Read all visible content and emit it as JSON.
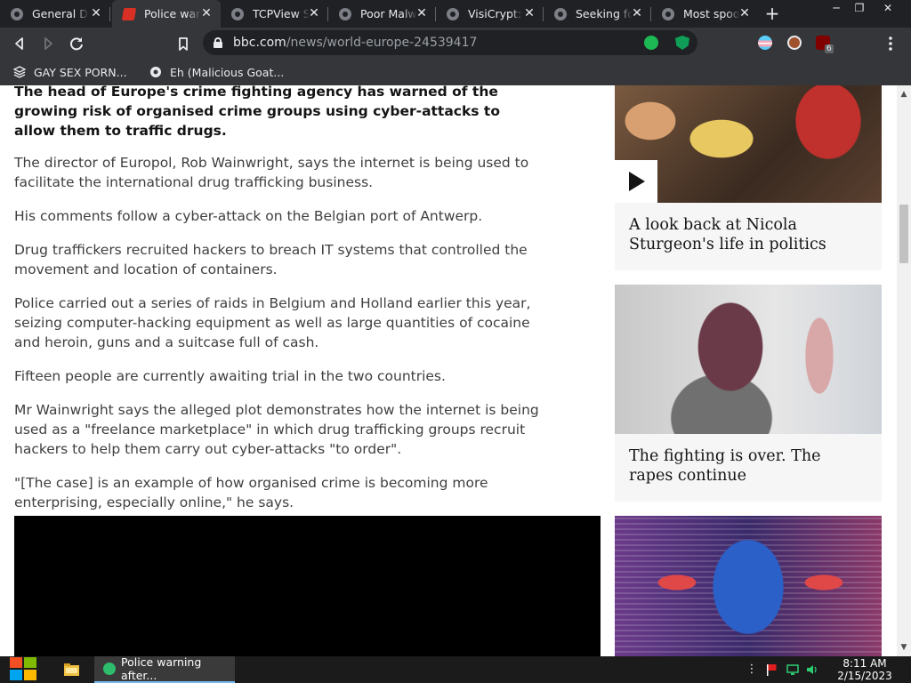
{
  "browser": {
    "tabs": [
      {
        "title": "General Discussion"
      },
      {
        "title": "Police warning after drug traffickers' cyber-attack"
      },
      {
        "title": "TCPView Sysinternals"
      },
      {
        "title": "Poor Malware"
      },
      {
        "title": "VisiCrypt: Free"
      },
      {
        "title": "Seeking for"
      },
      {
        "title": "Most spooky"
      }
    ],
    "close_glyph": "✕",
    "new_tab_glyph": "+",
    "active_tab_index": 1,
    "address": {
      "host": "bbc.com",
      "path": "/news/world-europe-24539417"
    },
    "extension_badge": "6",
    "bookmarks": [
      {
        "label": "GAY SEX PORN..."
      },
      {
        "label": "Eh (Malicious Goat..."
      }
    ]
  },
  "article": {
    "intro": "The head of Europe's crime fighting agency has warned of the growing risk of organised crime groups using cyber-attacks to allow them to traffic drugs.",
    "paragraphs": [
      "The director of Europol, Rob Wainwright, says the internet is being used to facilitate the international drug trafficking business.",
      "His comments follow a cyber-attack on the Belgian port of Antwerp.",
      "Drug traffickers recruited hackers to breach IT systems that controlled the movement and location of containers.",
      "Police carried out a series of raids in Belgium and Holland earlier this year, seizing computer-hacking equipment as well as large quantities of cocaine and heroin, guns and a suitcase full of cash.",
      "Fifteen people are currently awaiting trial in the two countries.",
      "Mr Wainwright says the alleged plot demonstrates how the internet is being used as a \"freelance marketplace\" in which drug trafficking groups recruit hackers to help them carry out cyber-attacks \"to order\".",
      "\"[The case] is an example of how organised crime is becoming more enterprising, especially online,\" he says."
    ]
  },
  "sidebar": {
    "promos": [
      {
        "title": "A look back at Nicola Sturgeon's life in politics",
        "has_video": true
      },
      {
        "title": "The fighting is over. The rapes continue",
        "has_video": false
      },
      {
        "title": "",
        "has_video": false
      }
    ]
  },
  "taskbar": {
    "active_window": "Police warning after...",
    "time": "8:11 AM",
    "date": "2/15/2023"
  },
  "colors": {
    "chrome_dark": "#202124",
    "chrome_toolbar": "#35363a",
    "article_text": "#3f3f42",
    "promo_bg": "#f6f6f6",
    "taskbar": "#1b1b1b"
  }
}
